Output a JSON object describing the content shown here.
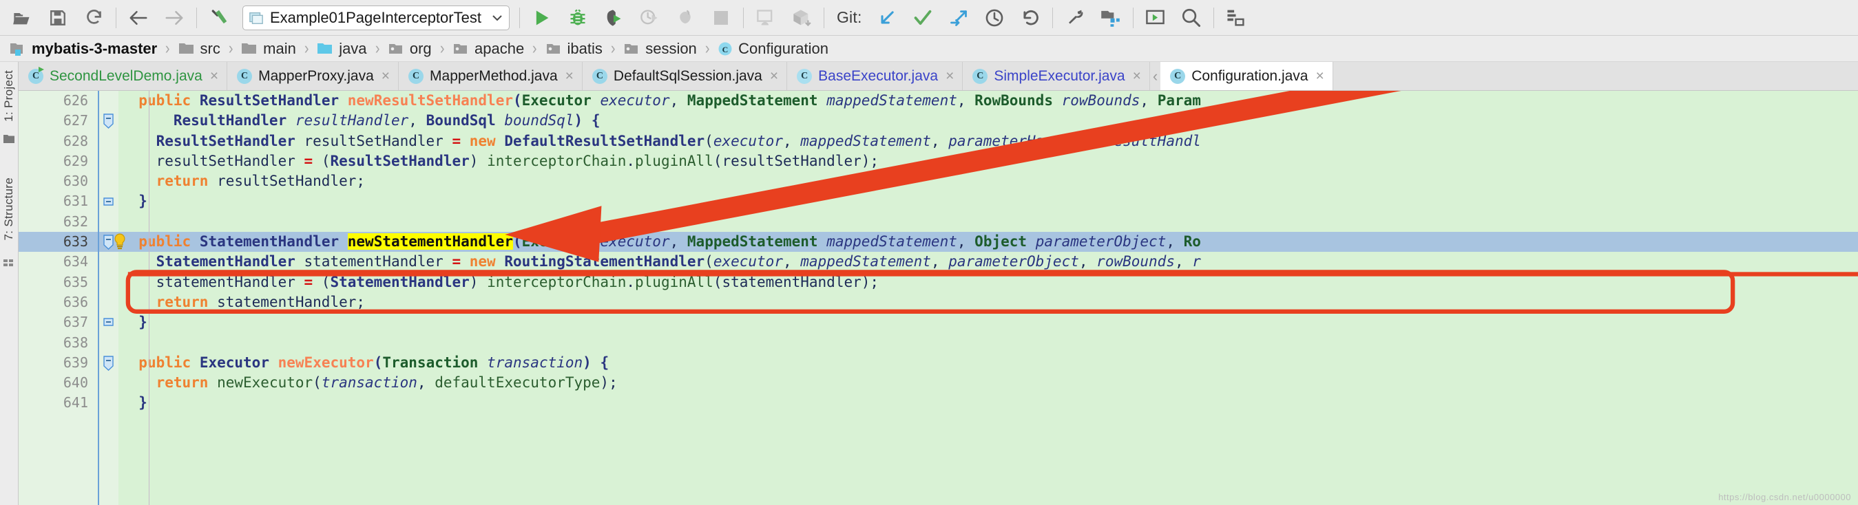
{
  "toolbar": {
    "icons_left": [
      {
        "name": "open-folder-icon",
        "label": "Open"
      },
      {
        "name": "save-all-icon",
        "label": "Save All"
      },
      {
        "name": "sync-refresh-icon",
        "label": "Synchronize"
      }
    ],
    "nav_icons": [
      {
        "name": "back-arrow-icon",
        "label": "Back"
      },
      {
        "name": "forward-arrow-icon",
        "label": "Forward"
      }
    ],
    "build_icon": {
      "name": "build-hammer-icon",
      "label": "Build Project"
    },
    "run_config": {
      "icon": "run-config-icon",
      "text": "Example01PageInterceptorTest",
      "arrow": "chevron-down-icon"
    },
    "run_icons": [
      {
        "name": "run-icon",
        "label": "Run"
      },
      {
        "name": "debug-icon",
        "label": "Debug"
      },
      {
        "name": "run-with-coverage-icon",
        "label": "Run with Coverage"
      },
      {
        "name": "profile-icon",
        "label": "Profile"
      },
      {
        "name": "attach-profiler-icon",
        "label": "Attach Profiler"
      },
      {
        "name": "stop-icon",
        "label": "Stop"
      }
    ],
    "android_icons": [
      {
        "name": "avd-manager-icon",
        "label": "AVD Manager"
      },
      {
        "name": "sdk-manager-icon",
        "label": "SDK Manager"
      }
    ],
    "git_label": "Git:",
    "git_icons": [
      {
        "name": "git-update-icon",
        "label": "Update Project"
      },
      {
        "name": "git-commit-icon",
        "label": "Commit"
      },
      {
        "name": "git-push-icon",
        "label": "Push"
      },
      {
        "name": "git-history-icon",
        "label": "Show History"
      },
      {
        "name": "git-revert-icon",
        "label": "Revert"
      }
    ],
    "right_icons": [
      {
        "name": "settings-wrench-icon",
        "label": "Settings"
      },
      {
        "name": "project-structure-icon",
        "label": "Project Structure"
      },
      {
        "name": "terminal-run-icon",
        "label": "Run Anything"
      },
      {
        "name": "search-icon",
        "label": "Search Everywhere"
      },
      {
        "name": "database-icon",
        "label": "Database"
      }
    ]
  },
  "breadcrumb": {
    "items": [
      {
        "label": "mybatis-3-master",
        "icon": "module-folder-icon",
        "kind": "module"
      },
      {
        "label": "src",
        "icon": "folder-icon",
        "kind": "folder"
      },
      {
        "label": "main",
        "icon": "folder-icon",
        "kind": "folder"
      },
      {
        "label": "java",
        "icon": "source-folder-icon",
        "kind": "source"
      },
      {
        "label": "org",
        "icon": "package-icon",
        "kind": "package"
      },
      {
        "label": "apache",
        "icon": "package-icon",
        "kind": "package"
      },
      {
        "label": "ibatis",
        "icon": "package-icon",
        "kind": "package"
      },
      {
        "label": "session",
        "icon": "package-icon",
        "kind": "package"
      },
      {
        "label": "Configuration",
        "icon": "class-icon",
        "kind": "class"
      }
    ],
    "separator": "›"
  },
  "left_strip": {
    "tabs": [
      {
        "label": "1: Project",
        "mnemonic": "1"
      },
      {
        "label": "7: Structure",
        "mnemonic": "7"
      }
    ],
    "icons": [
      {
        "name": "favorites-folder-icon"
      },
      {
        "name": "grid-view-icon"
      }
    ]
  },
  "tabs": {
    "close_glyph": "×",
    "chevron_left": "‹",
    "items": [
      {
        "label": "SecondLevelDemo.java",
        "color": "green",
        "active": false,
        "icon_letter": "C",
        "runnable": true
      },
      {
        "label": "MapperProxy.java",
        "color": "default",
        "active": false,
        "icon_letter": "C",
        "runnable": false
      },
      {
        "label": "MapperMethod.java",
        "color": "default",
        "active": false,
        "icon_letter": "C",
        "runnable": false
      },
      {
        "label": "DefaultSqlSession.java",
        "color": "default",
        "active": false,
        "icon_letter": "C",
        "runnable": false
      },
      {
        "label": "BaseExecutor.java",
        "color": "blue",
        "active": false,
        "icon_letter": "C",
        "runnable": false,
        "abstract": true
      },
      {
        "label": "SimpleExecutor.java",
        "color": "blue",
        "active": false,
        "icon_letter": "C",
        "runnable": false
      },
      {
        "label": "Configuration.java",
        "color": "default",
        "active": true,
        "icon_letter": "C",
        "runnable": false
      }
    ]
  },
  "editor": {
    "first_line_number": 626,
    "selected_line": 633,
    "line_numbers": [
      626,
      627,
      628,
      629,
      630,
      631,
      632,
      633,
      634,
      635,
      636,
      637,
      638,
      639,
      640,
      641
    ],
    "lines": [
      {
        "n": 626,
        "text": "  public ResultSetHandler newResultSetHandler(Executor executor, MappedStatement mappedStatement, RowBounds rowBounds, Param"
      },
      {
        "n": 627,
        "text": "      ResultHandler resultHandler, BoundSql boundSql) {"
      },
      {
        "n": 628,
        "text": "    ResultSetHandler resultSetHandler = new DefaultResultSetHandler(executor, mappedStatement, parameterHandler, resultHandl"
      },
      {
        "n": 629,
        "text": "    resultSetHandler = (ResultSetHandler) interceptorChain.pluginAll(resultSetHandler);"
      },
      {
        "n": 630,
        "text": "    return resultSetHandler;"
      },
      {
        "n": 631,
        "text": "  }"
      },
      {
        "n": 632,
        "text": ""
      },
      {
        "n": 633,
        "text": "  public StatementHandler newStatementHandler(Executor executor, MappedStatement mappedStatement, Object parameterObject, Ro"
      },
      {
        "n": 634,
        "text": "    StatementHandler statementHandler = new RoutingStatementHandler(executor, mappedStatement, parameterObject, rowBounds, r"
      },
      {
        "n": 635,
        "text": "    statementHandler = (StatementHandler) interceptorChain.pluginAll(statementHandler);"
      },
      {
        "n": 636,
        "text": "    return statementHandler;"
      },
      {
        "n": 637,
        "text": "  }"
      },
      {
        "n": 638,
        "text": ""
      },
      {
        "n": 639,
        "text": "  public Executor newExecutor(Transaction transaction) {"
      },
      {
        "n": 640,
        "text": "    return newExecutor(transaction, defaultExecutorType);"
      },
      {
        "n": 641,
        "text": "  }"
      }
    ],
    "highlighted_symbol": "newStatementHandler",
    "bulb_icon": "intention-bulb-icon",
    "fold_icons": [
      "fold-minus-icon"
    ]
  },
  "annotations": {
    "arrow": {
      "name": "red-arrow-annotation",
      "color": "#e8401f"
    },
    "box": {
      "name": "red-rectangle-annotation",
      "color": "#e8401f"
    },
    "underline": {
      "name": "red-underline-annotation",
      "color": "#e8401f"
    }
  },
  "colors": {
    "editor_background": "#d9f2d5",
    "gutter_background": "#e5f3e3",
    "selection": "#a8c4e0",
    "highlight": "#fdfd00",
    "keyword": "#ef8131",
    "type": "#2a3580",
    "method": "#f78153",
    "annotation_red": "#e8401f",
    "toolbar_background": "#ececec"
  },
  "watermark": "https://blog.csdn.net/u0000000"
}
